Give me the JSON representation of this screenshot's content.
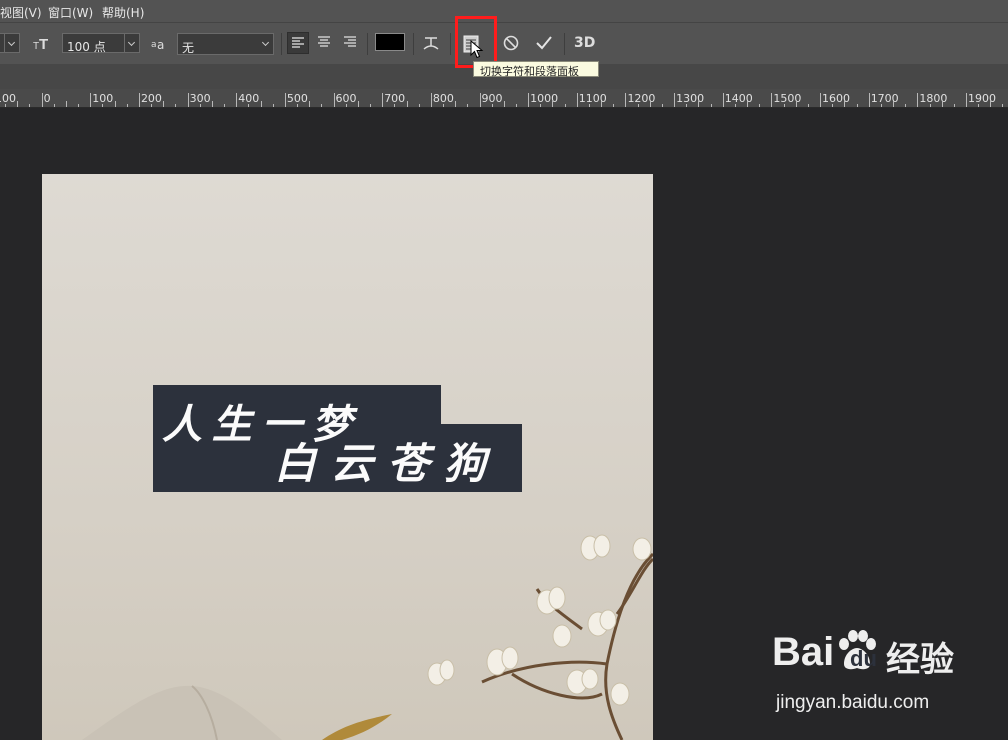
{
  "menubar": {
    "items": [
      "视图(V)",
      "窗口(W)",
      "帮助(H)"
    ]
  },
  "toolbar": {
    "font_size": "100 点",
    "anti_alias": "无",
    "text_color": "#000000",
    "threed_label": "3D",
    "tooltip": "切换字符和段落面板",
    "icons": [
      "orientation-toggle-icon",
      "font-size-icon",
      "anti-alias-icon",
      "align-left-icon",
      "align-center-icon",
      "align-right-icon",
      "warp-text-icon",
      "char-paragraph-panel-icon",
      "cancel-icon",
      "commit-icon",
      "3d-icon",
      "cursor-icon"
    ]
  },
  "ruler": {
    "labels": [
      "100",
      "0",
      "100",
      "200",
      "300",
      "400",
      "500",
      "600",
      "700",
      "800",
      "900",
      "1000",
      "1100",
      "1200",
      "1300",
      "1400",
      "1500",
      "1600",
      "1700",
      "1800",
      "1900"
    ]
  },
  "canvas": {
    "line1": "人 生 一 梦",
    "line2": "白 云 苍 狗"
  },
  "watermark": {
    "brand_bai": "Bai",
    "brand_du": "du",
    "brand_cn": "经验",
    "url": "jingyan.baidu.com"
  }
}
